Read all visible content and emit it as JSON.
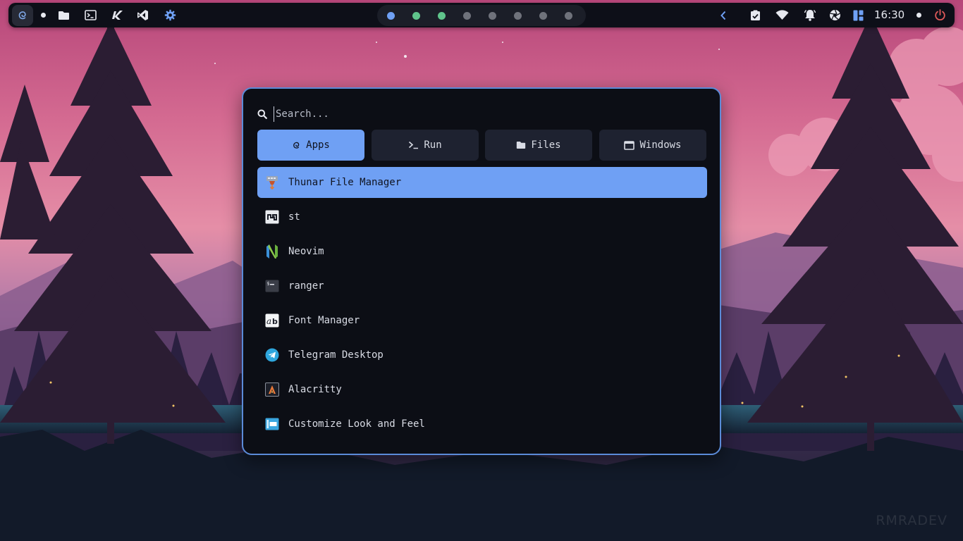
{
  "wallpaper": {
    "watermark": "RMRADEV"
  },
  "topbar": {
    "left_icons": [
      "debian-swirl-icon",
      "status-dot",
      "folder-icon",
      "terminal-icon",
      "text-editor-icon",
      "vscode-icon",
      "settings-gear-icon"
    ],
    "workspaces": [
      {
        "color": "#6fa0f4"
      },
      {
        "color": "#5fc48b"
      },
      {
        "color": "#5fc48b"
      },
      {
        "color": "#6f727b"
      },
      {
        "color": "#6f727b"
      },
      {
        "color": "#6f727b"
      },
      {
        "color": "#6f727b"
      },
      {
        "color": "#6f727b"
      }
    ],
    "right_icons": [
      "chevron-left-icon",
      "checklist-icon",
      "wifi-icon",
      "bell-icon",
      "aperture-icon",
      "layout-icon"
    ],
    "clock": "16:30",
    "power_color": "#e05a5a"
  },
  "launcher": {
    "search": {
      "placeholder": "Search...",
      "value": ""
    },
    "tabs": [
      {
        "label": "Apps",
        "icon": "debian-swirl-icon",
        "active": true
      },
      {
        "label": "Run",
        "icon": "prompt-icon",
        "active": false
      },
      {
        "label": "Files",
        "icon": "folder-icon",
        "active": false
      },
      {
        "label": "Windows",
        "icon": "window-icon",
        "active": false
      }
    ],
    "apps": [
      {
        "name": "Thunar File Manager",
        "icon": "thunar-icon",
        "selected": true
      },
      {
        "name": "st",
        "icon": "st-icon",
        "selected": false
      },
      {
        "name": "Neovim",
        "icon": "neovim-icon",
        "selected": false
      },
      {
        "name": "ranger",
        "icon": "ranger-icon",
        "selected": false
      },
      {
        "name": "Font Manager",
        "icon": "font-manager-icon",
        "selected": false
      },
      {
        "name": "Telegram Desktop",
        "icon": "telegram-icon",
        "selected": false
      },
      {
        "name": "Alacritty",
        "icon": "alacritty-icon",
        "selected": false
      },
      {
        "name": "Customize Look and Feel",
        "icon": "customize-icon",
        "selected": false
      }
    ]
  },
  "colors": {
    "accent": "#6fa0f4",
    "panel_bg": "#0c0e15",
    "border": "#5b8bd8"
  }
}
